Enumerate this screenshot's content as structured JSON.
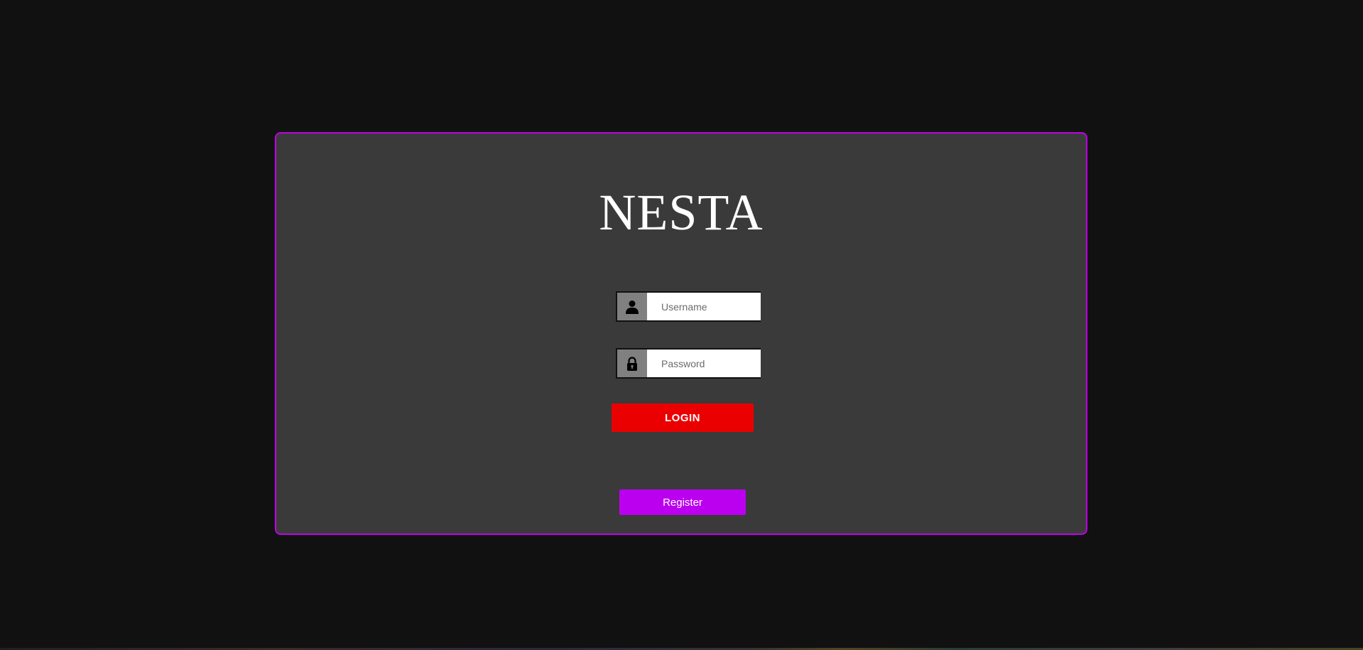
{
  "app": {
    "brand": "NESTA"
  },
  "login_form": {
    "username": {
      "placeholder": "Username",
      "value": "",
      "icon": "user-icon"
    },
    "password": {
      "placeholder": "Password",
      "value": "",
      "icon": "lock-icon"
    },
    "login_label": "LOGIN",
    "register_label": "Register"
  },
  "colors": {
    "background": "#111112",
    "card": "#3a3a3a",
    "card_border": "#c000e8",
    "login_button": "#ea0000",
    "register_button": "#bb00f0",
    "icon_box": "#808080"
  }
}
